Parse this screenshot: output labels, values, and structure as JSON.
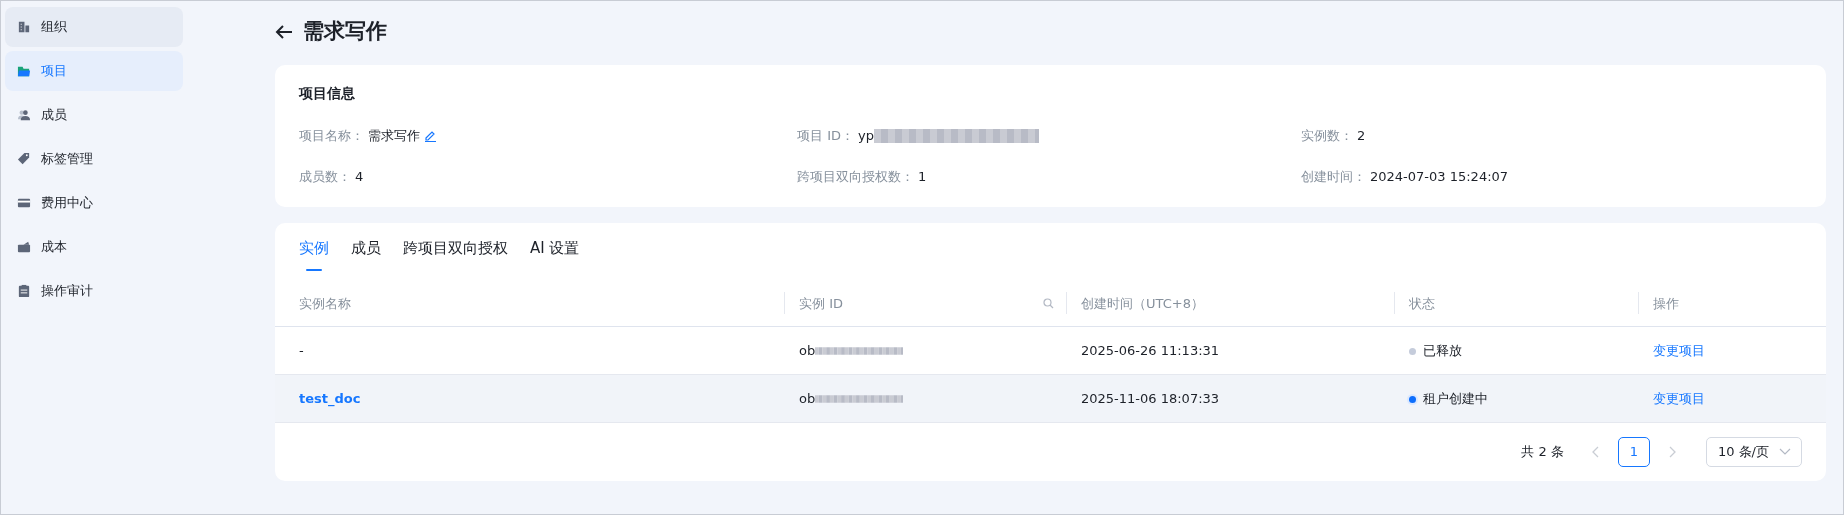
{
  "sidebar": {
    "items": [
      {
        "label": "组织",
        "selected": false,
        "hovered": true
      },
      {
        "label": "项目",
        "selected": true,
        "hovered": false
      },
      {
        "label": "成员",
        "selected": false,
        "hovered": false
      },
      {
        "label": "标签管理",
        "selected": false,
        "hovered": false
      },
      {
        "label": "费用中心",
        "selected": false,
        "hovered": false
      },
      {
        "label": "成本",
        "selected": false,
        "hovered": false
      },
      {
        "label": "操作审计",
        "selected": false,
        "hovered": false
      }
    ]
  },
  "page_title": "需求写作",
  "info_card": {
    "title": "项目信息",
    "fields": [
      {
        "label": "项目名称：",
        "value": "需求写作",
        "editable": true,
        "redacted": false
      },
      {
        "label": "项目 ID：",
        "value": "yp",
        "editable": false,
        "redacted": true
      },
      {
        "label": "实例数：",
        "value": "2",
        "editable": false,
        "redacted": false
      },
      {
        "label": "成员数：",
        "value": "4",
        "editable": false,
        "redacted": false
      },
      {
        "label": "跨项目双向授权数：",
        "value": "1",
        "editable": false,
        "redacted": false
      },
      {
        "label": "创建时间：",
        "value": "2024-07-03 15:24:07",
        "editable": false,
        "redacted": false
      }
    ]
  },
  "tabs": [
    {
      "label": "实例",
      "selected": true
    },
    {
      "label": "成员",
      "selected": false
    },
    {
      "label": "跨项目双向授权",
      "selected": false
    },
    {
      "label": "AI 设置",
      "selected": false
    }
  ],
  "table": {
    "columns": [
      {
        "label": "实例名称",
        "searchable": false
      },
      {
        "label": "实例 ID",
        "searchable": true
      },
      {
        "label": "创建时间（UTC+8）",
        "searchable": false
      },
      {
        "label": "状态",
        "searchable": false
      },
      {
        "label": "操作",
        "searchable": false
      }
    ],
    "rows": [
      {
        "name": "-",
        "name_link": false,
        "id": "ob",
        "id_redacted": true,
        "created": "2025-06-26 11:13:31",
        "status": "已释放",
        "color": "#c5ccdb",
        "status_ring": false,
        "action": "变更项目",
        "hovered": false
      },
      {
        "name": "test_doc",
        "name_link": true,
        "id": "ob",
        "id_redacted": true,
        "created": "2025-11-06 18:07:33",
        "status": "租户创建中",
        "color": "#0d6efd",
        "status_ring": true,
        "action": "变更项目",
        "hovered": true
      }
    ]
  },
  "pagination": {
    "total": "共 2 条",
    "pages": [
      {
        "label": "1",
        "selected": true
      }
    ],
    "page_size": "10 条/页"
  }
}
